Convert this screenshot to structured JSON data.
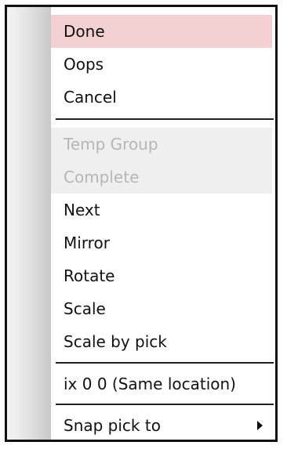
{
  "menu": {
    "items": [
      {
        "label": "Done"
      },
      {
        "label": "Oops"
      },
      {
        "label": "Cancel"
      },
      {
        "label": "Temp Group"
      },
      {
        "label": "Complete"
      },
      {
        "label": "Next"
      },
      {
        "label": "Mirror"
      },
      {
        "label": "Rotate"
      },
      {
        "label": "Scale"
      },
      {
        "label": "Scale by pick"
      },
      {
        "label": "ix 0 0 (Same location)"
      },
      {
        "label": "Snap pick to",
        "icon": "submenu-arrow-icon"
      }
    ]
  },
  "colors": {
    "highlight": "#f3d0d2",
    "disabled_text": "#b6b6b6",
    "disabled_bg": "#efefef",
    "frame": "#111111"
  }
}
